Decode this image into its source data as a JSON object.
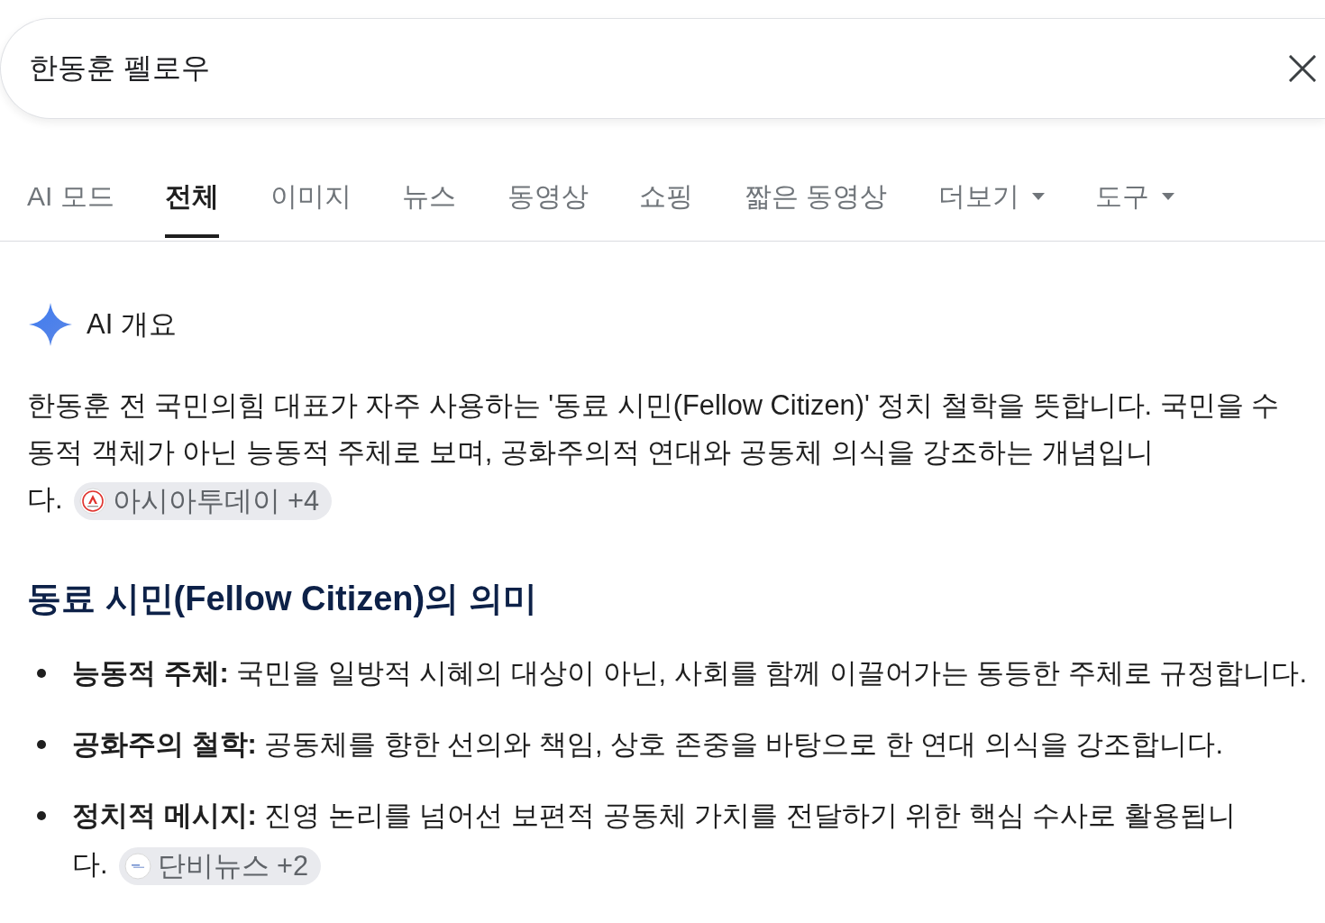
{
  "search": {
    "value": "한동훈 펠로우"
  },
  "tabs": [
    {
      "label": "AI 모드",
      "selected": false,
      "kind": "link"
    },
    {
      "label": "전체",
      "selected": true,
      "kind": "link"
    },
    {
      "label": "이미지",
      "selected": false,
      "kind": "link"
    },
    {
      "label": "뉴스",
      "selected": false,
      "kind": "link"
    },
    {
      "label": "동영상",
      "selected": false,
      "kind": "link"
    },
    {
      "label": "쇼핑",
      "selected": false,
      "kind": "link"
    },
    {
      "label": "짧은 동영상",
      "selected": false,
      "kind": "link"
    },
    {
      "label": "더보기",
      "selected": false,
      "kind": "menu"
    },
    {
      "label": "도구",
      "selected": false,
      "kind": "menu"
    }
  ],
  "ai_overview": {
    "title": "AI 개요",
    "summary": {
      "text": "한동훈 전 국민의힘 대표가 자주 사용하는 '동료 시민(Fellow Citizen)' 정치 철학을 뜻합니다. 국민을 수동적 객체가 아닌 능동적 주체로 보며, 공화주의적 연대와 공동체 의식을 강조하는 개념입니다.",
      "source": "아시아투데이 +4"
    }
  },
  "section": {
    "heading": "동료 시민(Fellow Citizen)의 의미",
    "bullets": [
      {
        "term": "능동적 주체:",
        "text": "국민을 일방적 시혜의 대상이 아닌, 사회를 함께 이끌어가는 동등한 주체로 규정합니다."
      },
      {
        "term": "공화주의 철학:",
        "text": "공동체를 향한 선의와 책임, 상호 존중을 바탕으로 한 연대 의식을 강조합니다."
      },
      {
        "term": "정치적 메시지:",
        "text": "진영 논리를 넘어선 보편적 공동체 가치를 전달하기 위한 핵심 수사로 활용됩니다.",
        "source": "단비뉴스 +2"
      }
    ]
  }
}
